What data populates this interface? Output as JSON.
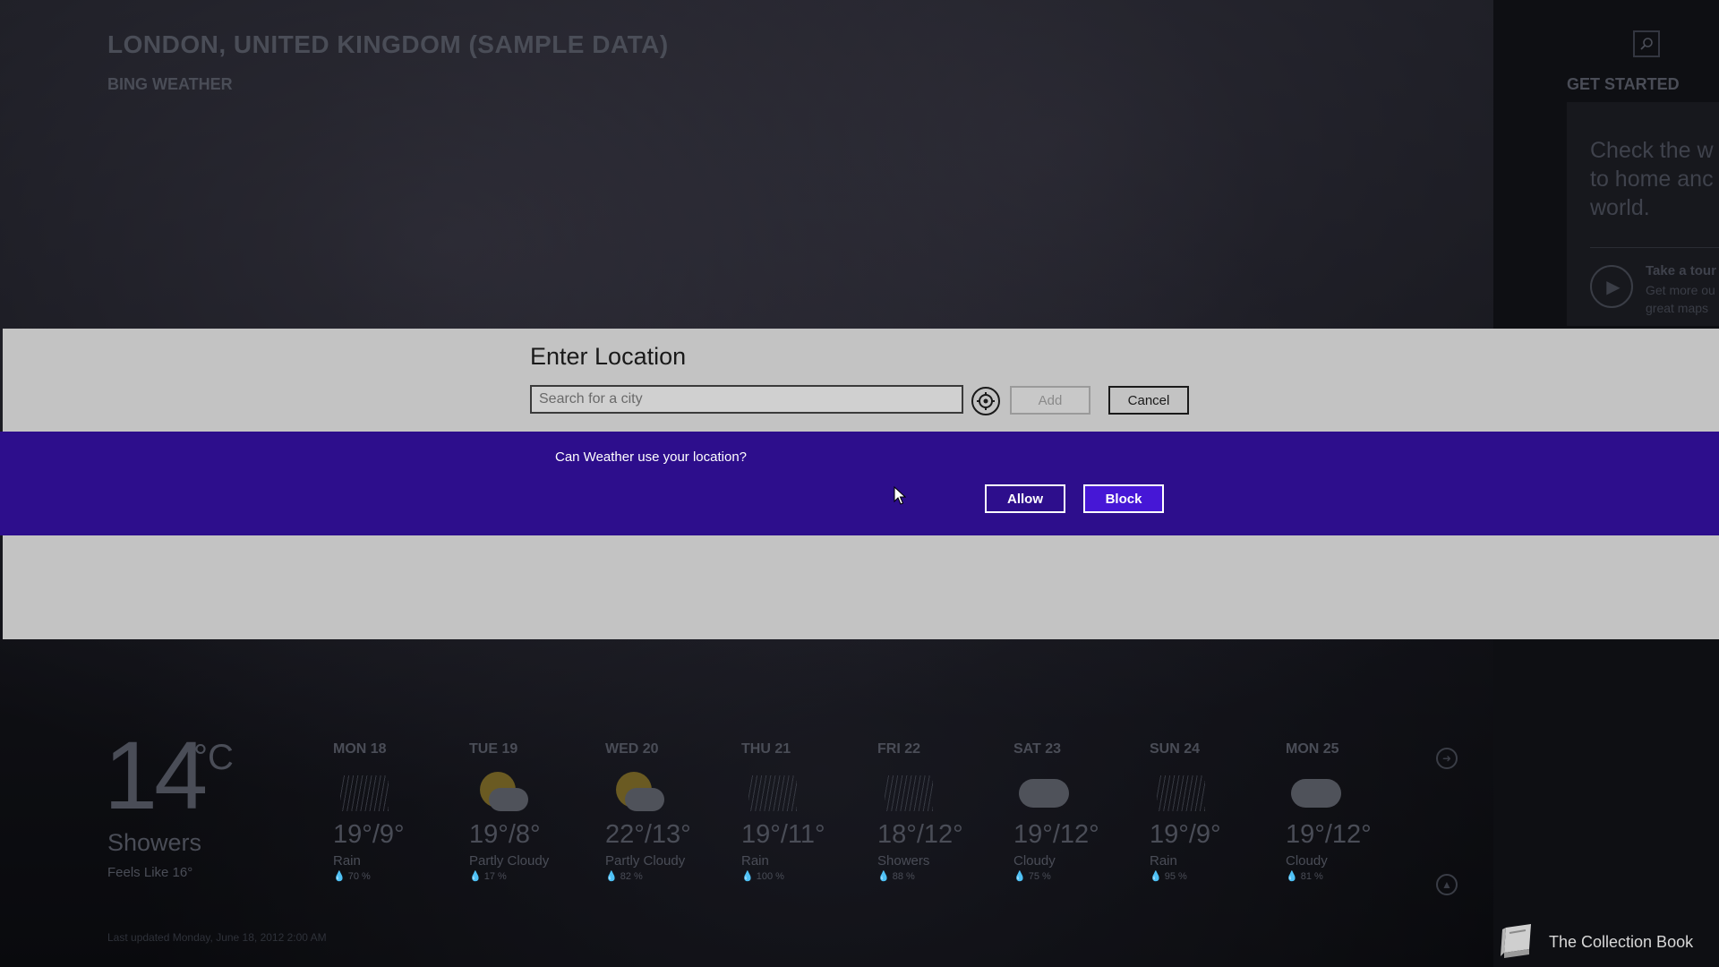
{
  "header": {
    "title": "LONDON, UNITED KINGDOM (SAMPLE DATA)",
    "subtitle": "BING WEATHER"
  },
  "right_panel": {
    "heading": "GET STARTED",
    "card_text": "Check the w\nto home anc\nworld.",
    "tour_title": "Take a tour",
    "tour_sub": "Get more ou\ngreat maps"
  },
  "dialog": {
    "title": "Enter Location",
    "search_placeholder": "Search for a city",
    "add_label": "Add",
    "cancel_label": "Cancel"
  },
  "permission": {
    "question": "Can Weather use your location?",
    "allow_label": "Allow",
    "block_label": "Block"
  },
  "current": {
    "temp": "14",
    "unit": "°C",
    "condition": "Showers",
    "feels_like": "Feels Like 16°",
    "last_updated": "Last updated Monday, June 18, 2012 2:00 AM"
  },
  "forecast": [
    {
      "day": "MON 18",
      "temp": "19°/9°",
      "cond": "Rain",
      "precip": "💧 70 %",
      "icon": "rain-icon"
    },
    {
      "day": "TUE 19",
      "temp": "19°/8°",
      "cond": "Partly Cloudy",
      "precip": "💧 17 %",
      "icon": "partly-cloudy-icon"
    },
    {
      "day": "WED 20",
      "temp": "22°/13°",
      "cond": "Partly Cloudy",
      "precip": "💧 82 %",
      "icon": "partly-cloudy-icon"
    },
    {
      "day": "THU 21",
      "temp": "19°/11°",
      "cond": "Rain",
      "precip": "💧 100 %",
      "icon": "rain-icon"
    },
    {
      "day": "FRI 22",
      "temp": "18°/12°",
      "cond": "Showers",
      "precip": "💧 88 %",
      "icon": "showers-icon"
    },
    {
      "day": "SAT 23",
      "temp": "19°/12°",
      "cond": "Cloudy",
      "precip": "💧 75 %",
      "icon": "cloudy-icon"
    },
    {
      "day": "SUN 24",
      "temp": "19°/9°",
      "cond": "Rain",
      "precip": "💧 95 %",
      "icon": "rain-icon"
    },
    {
      "day": "MON 25",
      "temp": "19°/12°",
      "cond": "Cloudy",
      "precip": "💧 81 %",
      "icon": "cloudy-icon"
    }
  ],
  "taskbar": {
    "app_name": "The Collection Book",
    "app_icon": "book-icon"
  },
  "colors": {
    "permission_bar": "#2d0e8c",
    "block_button": "#4617d6",
    "dialog_bg": "#c3c3c3"
  }
}
